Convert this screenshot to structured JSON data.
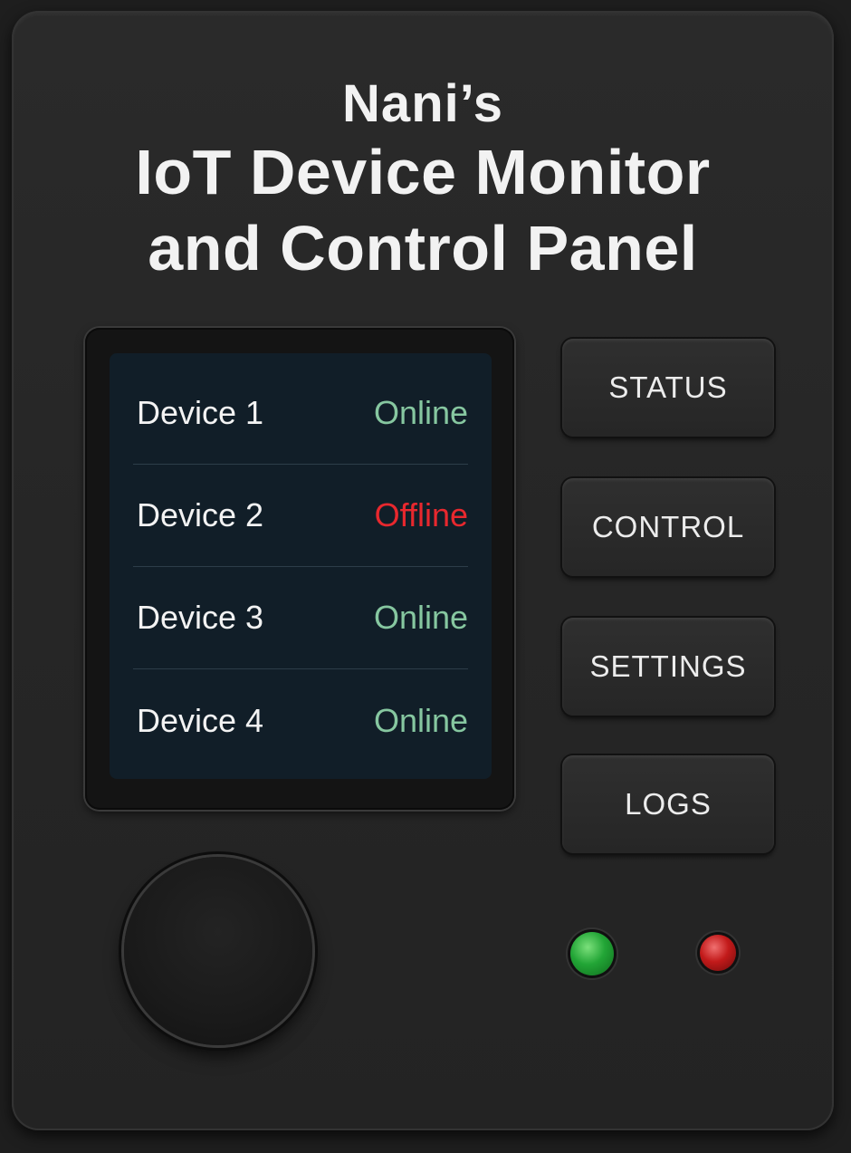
{
  "title": {
    "owner": "Nani’s",
    "line1": "IoT Device Monitor",
    "line2": "and Control Panel"
  },
  "devices": [
    {
      "name": "Device 1",
      "state": "Online",
      "state_color": "#86c7a0"
    },
    {
      "name": "Device 2",
      "state": "Offline",
      "state_color": "#e8282e"
    },
    {
      "name": "Device 3",
      "state": "Online",
      "state_color": "#86c7a0"
    },
    {
      "name": "Device 4",
      "state": "Online",
      "state_color": "#86c7a0"
    }
  ],
  "buttons": [
    {
      "label": "STATUS"
    },
    {
      "label": "CONTROL"
    },
    {
      "label": "SETTINGS"
    },
    {
      "label": "LOGS"
    }
  ],
  "indicators": [
    {
      "icon": "green-led-icon",
      "color": "#22a536"
    },
    {
      "icon": "red-led-icon",
      "color": "#c21a1a"
    }
  ],
  "colors": {
    "panel": "#262626",
    "screen": "#111e28",
    "text": "#f2f2f2"
  }
}
